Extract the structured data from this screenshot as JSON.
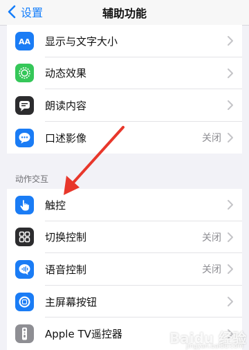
{
  "nav": {
    "back_label": "设置",
    "title": "辅助功能"
  },
  "group1": {
    "items": [
      {
        "label": "显示与文字大小",
        "value": "",
        "icon": "text-size-icon",
        "color": "#1a7cf5"
      },
      {
        "label": "动态效果",
        "value": "",
        "icon": "motion-icon",
        "color": "#35c759"
      },
      {
        "label": "朗读内容",
        "value": "",
        "icon": "speech-bubble-icon",
        "color": "#2c2c2e"
      },
      {
        "label": "口述影像",
        "value": "关闭",
        "icon": "audio-description-icon",
        "color": "#1a7cf5"
      }
    ]
  },
  "section2": {
    "header": "动作交互",
    "items": [
      {
        "label": "触控",
        "value": "",
        "icon": "hand-touch-icon",
        "color": "#1a7cf5"
      },
      {
        "label": "切换控制",
        "value": "关闭",
        "icon": "switch-control-icon",
        "color": "#2c2c2e"
      },
      {
        "label": "语音控制",
        "value": "关闭",
        "icon": "voice-control-icon",
        "color": "#1a7cf5"
      },
      {
        "label": "主屏幕按钮",
        "value": "",
        "icon": "home-button-icon",
        "color": "#1a7cf5"
      },
      {
        "label": "Apple TV遥控器",
        "value": "",
        "icon": "tv-remote-icon",
        "color": "#8e8e93"
      }
    ]
  },
  "annotation": {
    "color": "#e8372b"
  },
  "watermark": {
    "text": "Baidu 经验",
    "sub": "jingyan.baidu.com"
  }
}
